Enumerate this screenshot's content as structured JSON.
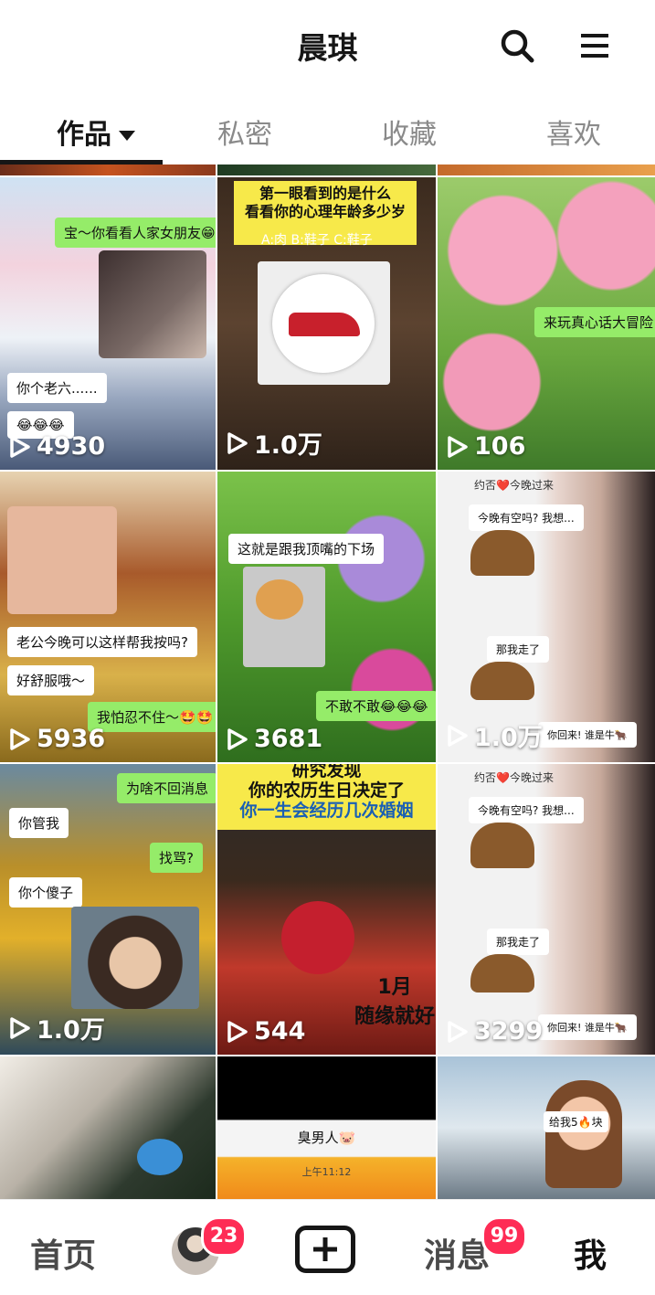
{
  "header": {
    "title": "晨琪"
  },
  "tabs": [
    {
      "label": "作品",
      "active": true
    },
    {
      "label": "私密",
      "active": false
    },
    {
      "label": "收藏",
      "active": false
    },
    {
      "label": "喜欢",
      "active": false
    }
  ],
  "videos": [
    {
      "count": "4930",
      "texts": [
        "宝～你看看人家女朋友😁",
        "你个老六......",
        "😂😂😂"
      ]
    },
    {
      "count": "1.0万",
      "texts": [
        "第一眼看到的是什么",
        "看看你的心理年龄多少岁",
        "A:肉  B:鞋子  C:鞋子"
      ]
    },
    {
      "count": "106",
      "texts": [
        "来玩真心话大冒险"
      ]
    },
    {
      "count": "5936",
      "texts": [
        "老公今晚可以这样帮我按吗?",
        "好舒服哦～",
        "我怕忍不住～🤩🤩"
      ]
    },
    {
      "count": "3681",
      "texts": [
        "这就是跟我顶嘴的下场",
        "不敢不敢😂😂😂"
      ]
    },
    {
      "count": "1.0万",
      "texts": [
        "约否❤️今晚过来",
        "今晚有空吗? 我想...",
        "那我走了",
        "你回来! 谁是牛🐂"
      ]
    },
    {
      "count": "1.0万",
      "texts": [
        "为啥不回消息",
        "你管我",
        "找骂?",
        "你个傻子"
      ]
    },
    {
      "count": "544",
      "texts": [
        "研究发现",
        "你的农历生日决定了",
        "你一生会经历几次婚姻",
        "1月",
        "随缘就好"
      ]
    },
    {
      "count": "3299",
      "texts": [
        "约否❤️今晚过来",
        "今晚有空吗? 我想...",
        "那我走了",
        "你回来! 谁是牛🐂"
      ]
    },
    {
      "count": "",
      "texts": []
    },
    {
      "count": "",
      "texts": [
        "臭男人🐷",
        "上午11:12"
      ]
    },
    {
      "count": "",
      "texts": [
        "给我5🔥块"
      ]
    }
  ],
  "bottom_nav": {
    "home": "首页",
    "friends_badge": "23",
    "messages": "消息",
    "messages_badge": "99",
    "me": "我"
  }
}
